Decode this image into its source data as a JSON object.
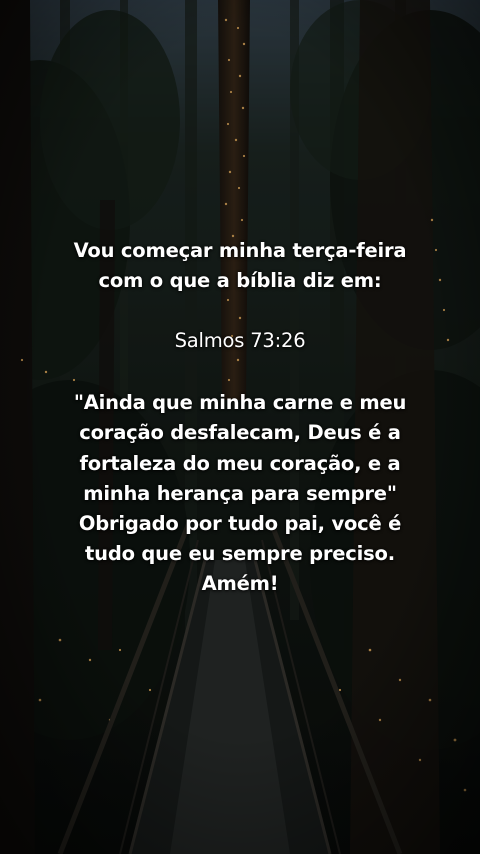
{
  "intro_lines": [
    "Vou começar minha terça-feira",
    "com o que a bíblia diz em:"
  ],
  "reference": "Salmos 73:26",
  "verse_lines": [
    "\"Ainda que minha carne e meu",
    "coração desfalecam, Deus é a",
    "fortaleza do meu coração, e a",
    "minha herança para sempre\""
  ],
  "prayer_lines": [
    "Obrigado por tudo pai, você é",
    "tudo que eu sempre preciso.",
    "Amém!"
  ],
  "colors": {
    "text": "#ffffff",
    "forest_dark": "#0d110d",
    "light_glow": "#e8b060"
  }
}
